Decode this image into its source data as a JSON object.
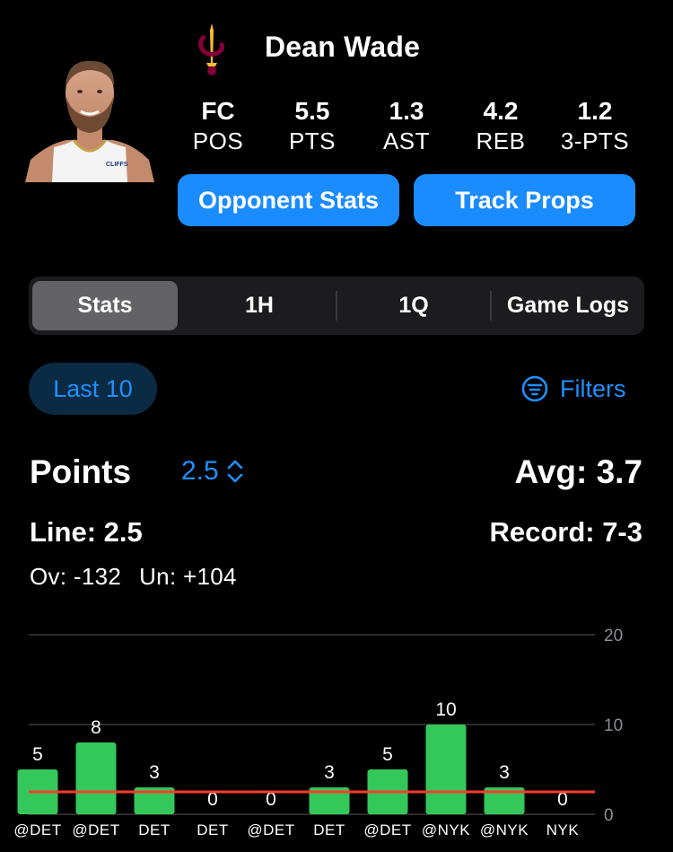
{
  "player": {
    "name": "Dean Wade",
    "team_logo": "cavaliers-sword-icon",
    "jersey_text": "CLIFFS",
    "stats": [
      {
        "value": "FC",
        "label": "POS"
      },
      {
        "value": "5.5",
        "label": "PTS"
      },
      {
        "value": "1.3",
        "label": "AST"
      },
      {
        "value": "4.2",
        "label": "REB"
      },
      {
        "value": "1.2",
        "label": "3-PTS"
      }
    ]
  },
  "actions": {
    "opponent_stats": "Opponent Stats",
    "track_props": "Track Props"
  },
  "segments": [
    "Stats",
    "1H",
    "1Q",
    "Game Logs"
  ],
  "active_segment": "Stats",
  "range_chip": "Last 10",
  "filters_label": "Filters",
  "prop": {
    "title": "Points",
    "line_value": "2.5",
    "avg": "Avg: 3.7",
    "line_text": "Line: 2.5",
    "record": "Record: 7-3",
    "over": "Ov: -132",
    "under": "Un: +104"
  },
  "colors": {
    "accent": "#1e90ff",
    "button": "#1a8cff",
    "bar_green": "#34c759",
    "line_red": "#ff3b30"
  },
  "chart_data": {
    "type": "bar",
    "categories": [
      "@DET",
      "@DET",
      "DET",
      "DET",
      "@DET",
      "DET",
      "@DET",
      "@NYK",
      "@NYK",
      "NYK"
    ],
    "values": [
      5,
      8,
      3,
      0,
      0,
      3,
      5,
      10,
      3,
      0
    ],
    "ylim": [
      0,
      20
    ],
    "yticks": [
      0,
      10,
      20
    ],
    "reference_line": 2.5,
    "grid": true
  }
}
